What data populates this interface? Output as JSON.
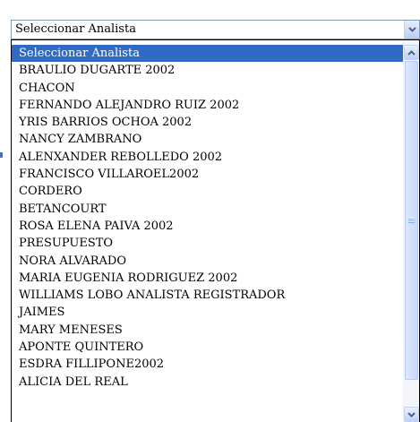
{
  "select": {
    "value": "Seleccionar Analista",
    "arrow_icon": "chevron-down-icon"
  },
  "options": [
    {
      "label": "Seleccionar Analista",
      "selected": true
    },
    {
      "label": "BRAULIO DUGARTE 2002"
    },
    {
      "label": "CHACON"
    },
    {
      "label": "FERNANDO ALEJANDRO RUIZ 2002"
    },
    {
      "label": "YRIS BARRIOS OCHOA 2002"
    },
    {
      "label": "NANCY ZAMBRANO"
    },
    {
      "label": "ALENXANDER REBOLLEDO 2002"
    },
    {
      "label": "FRANCISCO VILLAROEL2002"
    },
    {
      "label": "CORDERO"
    },
    {
      "label": "BETANCOURT"
    },
    {
      "label": "ROSA ELENA PAIVA 2002"
    },
    {
      "label": "PRESUPUESTO"
    },
    {
      "label": "NORA ALVARADO"
    },
    {
      "label": "MARIA EUGENIA RODRIGUEZ 2002"
    },
    {
      "label": "WILLIAMS LOBO ANALISTA REGISTRADOR"
    },
    {
      "label": "JAIMES"
    },
    {
      "label": "MARY MENESES"
    },
    {
      "label": "APONTE QUINTERO"
    },
    {
      "label": "ESDRA FILLIPONE2002"
    },
    {
      "label": "ALICIA DEL REAL"
    }
  ],
  "colors": {
    "selected_bg": "#316ac5",
    "selected_fg": "#ffffff",
    "border": "#7f9db9"
  }
}
